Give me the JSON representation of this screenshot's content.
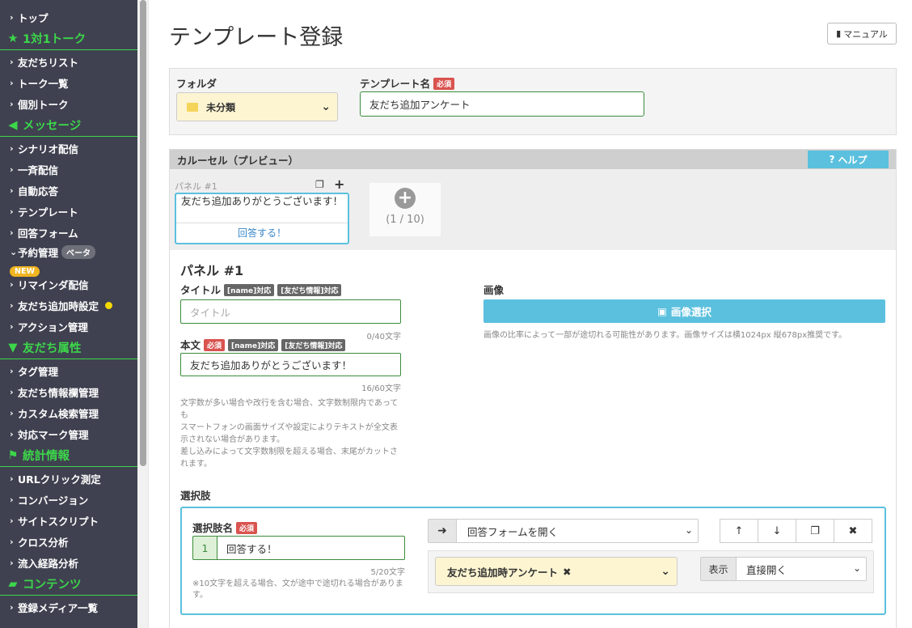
{
  "sidebar": {
    "top": "トップ",
    "sec1": {
      "title": "1対1トーク",
      "icon": "star-icon"
    },
    "items1": [
      "友だちリスト",
      "トーク一覧",
      "個別トーク"
    ],
    "sec2": {
      "title": "メッセージ",
      "icon": "megaphone-icon"
    },
    "items2": [
      "シナリオ配信",
      "一斉配信",
      "自動応答",
      "テンプレート",
      "回答フォーム"
    ],
    "reserve": "予約管理",
    "beta": "ベータ",
    "new_badge": "NEW",
    "items2b": [
      "リマインダ配信",
      "友だち追加時設定",
      "アクション管理"
    ],
    "sec3": {
      "title": "友だち属性",
      "icon": "filter-icon"
    },
    "items3": [
      "タグ管理",
      "友だち情報欄管理",
      "カスタム検索管理",
      "対応マーク管理"
    ],
    "sec4": {
      "title": "統計情報",
      "icon": "flag-icon"
    },
    "items4": [
      "URLクリック測定",
      "コンバージョン",
      "サイトスクリプト",
      "クロス分析",
      "流入経路分析"
    ],
    "sec5": {
      "title": "コンテンツ",
      "icon": "folder-open-icon"
    },
    "items5": [
      "登録メディア一覧"
    ]
  },
  "header": {
    "title": "テンプレート登録",
    "manual": "マニュアル"
  },
  "folder": {
    "label": "フォルダ",
    "value": "未分類",
    "name_label": "テンプレート名",
    "required": "必須",
    "name_value": "友だち追加アンケート"
  },
  "carousel": {
    "title": "カルーセル（プレビュー）",
    "help": "ヘルプ",
    "panel_label": "パネル #1",
    "card_text": "友だち追加ありがとうございます！",
    "card_button": "回答する！",
    "count": "(1 / 10)"
  },
  "panel": {
    "heading": "パネル #1",
    "title_label": "タイトル",
    "tag_name": "[name]対応",
    "tag_info": "[友だち情報]対応",
    "title_placeholder": "タイトル",
    "title_counter": "0/40文字",
    "body_label": "本文",
    "required": "必須",
    "body_value": "友だち追加ありがとうございます！",
    "body_counter": "16/60文字",
    "note1": "文字数が多い場合や改行を含む場合、文字数制限内であっても",
    "note2": "スマートフォンの画面サイズや設定によりテキストが全文表示されない場合があります。",
    "note3": "差し込みによって文字数制限を超える場合、末尾がカットされます。",
    "image_label": "画像",
    "image_button": "画像選択",
    "image_note": "画像の比率によって一部が途切れる可能性があります。画像サイズは横1024px 縦678px推奨です。"
  },
  "choices": {
    "label": "選択肢",
    "name_label": "選択肢名",
    "required": "必須",
    "num": "1",
    "value": "回答する！",
    "counter": "5/20文字",
    "note": "※10文字を超える場合、文が途中で途切れる場合があります。",
    "action": "回答フォームを開く",
    "form": "友だち追加時アンケート",
    "show_label": "表示",
    "open_mode": "直接開く"
  }
}
